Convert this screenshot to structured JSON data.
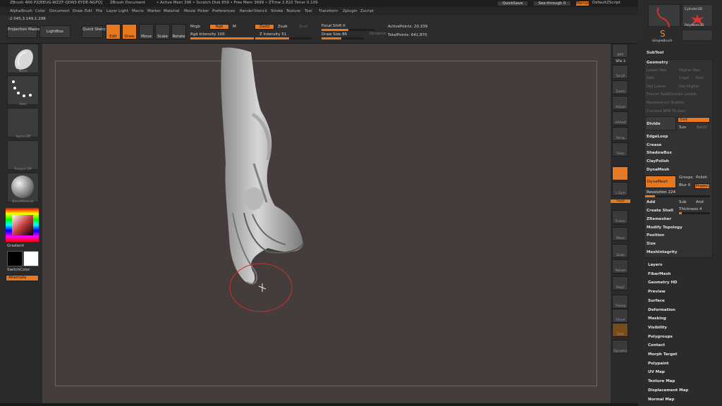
{
  "titlebar": {
    "app": "ZBrush 4R6 P2[BEUG-WZZF-QDN3-EYDE-NGFQ]",
    "document": "ZBrush Document",
    "stats": "• Active Mem 396 • Scratch Disk 659 • Free Mem 3699 • ZTime 2.822 Timer 0.109",
    "quicksave": "QuickSave",
    "seethrough": "See-through 0",
    "menus": "Menus",
    "script": "DefaultZScript"
  },
  "menubar": {
    "items": [
      "Alpha",
      "Brush",
      "Color",
      "Document",
      "Draw",
      "Edit",
      "File",
      "Layer",
      "Light",
      "Macro",
      "Marker",
      "Material",
      "Movie",
      "Picker",
      "Preferences",
      "Render",
      "Stencil",
      "Stroke",
      "Texture",
      "Tool",
      "Transform",
      "Zplugin",
      "Zscript"
    ]
  },
  "coords": "-2.045,3.149,1.298",
  "toolbar": {
    "projection_master": "Projection Master",
    "lightbox": "LightBox",
    "quick_sketch": "Quick Sketch",
    "edit": "Edit",
    "draw": "Draw",
    "move": "Move",
    "scale": "Scale",
    "rotate": "Rotate",
    "mrgb": "Mrgb",
    "rgb": "Rgb",
    "m": "M",
    "zadd": "Zadd",
    "zsub": "Zsub",
    "zcut": "Zcut",
    "rgb_intensity": "Rgb Intensity 100",
    "z_intensity": "Z Intensity 51",
    "focal_shift": "Focal Shift 0",
    "draw_size": "Draw Size 86",
    "dynamic": "Dynamic",
    "active_points": "ActivePoints: 20,339",
    "total_points": "TotalPoints: 641,870"
  },
  "leftshelf": {
    "brush": "Move",
    "stroke": "Dots",
    "alpha": "Alpha Off",
    "texture": "Texture Off",
    "material": "BasicMaterial",
    "gradient": "Gradient",
    "switchcolor": "SwitchColor",
    "alternate": "Alternate"
  },
  "rightshelf": {
    "labels": [
      "BPR",
      "SPix 3",
      "Scroll",
      "Zoom",
      "Actual",
      "AAHalf",
      "Persp",
      "Floor",
      "Local",
      "L.Sym",
      "Gxyz",
      "Frame",
      "Move",
      "Scale",
      "Rotate",
      "PolyF",
      "Transp",
      "Ghost",
      "Solo",
      "Dynamic"
    ]
  },
  "rightpanel": {
    "tools": [
      "Cylinder3D",
      "PolyMesh3D",
      "SimpleBrush"
    ],
    "subtool": "SubTool",
    "geometry": "Geometry",
    "geo_dim": [
      "Lower Res",
      "Higher Res",
      "Sdiv",
      "Cage",
      "Rstr",
      "Del Lower",
      "Del Higher",
      "Freeze SubDivision Levels",
      "Reconstruct Subdiv",
      "Convert BPR To Geo"
    ],
    "divide": "Divide",
    "smt": "Smt",
    "suv": "Suv",
    "reuv": "ReUV",
    "edgeloop": "EdgeLoop",
    "crease": "Crease",
    "shadowbox": "ShadowBox",
    "claypolish": "ClayPolish",
    "dynamesh_head": "DynaMesh",
    "dynamesh_btn": "DynaMesh",
    "groups": "Groups",
    "polish": "Polish",
    "blur": "Blur 0",
    "project": "Project",
    "resolution": "Resolution 224",
    "add": "Add",
    "sub": "Sub",
    "and": "And",
    "create_shell": "Create Shell",
    "thickness": "Thickness 4",
    "zremesher": "ZRemesher",
    "modify_topology": "Modify Topology",
    "position": "Position",
    "size": "Size",
    "meshintegrity": "MeshIntegrity",
    "sections": [
      "Layers",
      "FiberMesh",
      "Geometry HD",
      "Preview",
      "Surface",
      "Deformation",
      "Masking",
      "Visibility",
      "Polygroups",
      "Contact",
      "Morph Target",
      "Polypaint",
      "UV Map",
      "Texture Map",
      "Displacement Map",
      "Normal Map"
    ]
  }
}
